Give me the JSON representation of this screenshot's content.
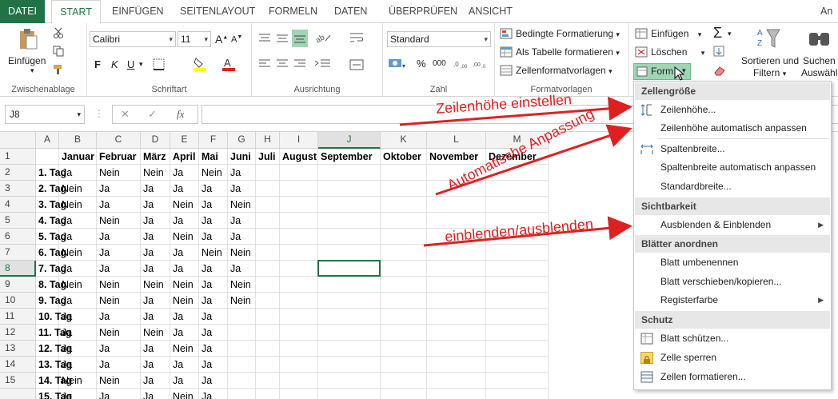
{
  "tabs": [
    "DATEI",
    "START",
    "EINFÜGEN",
    "SEITENLAYOUT",
    "FORMELN",
    "DATEN",
    "ÜBERPRÜFEN",
    "ANSICHT"
  ],
  "tabs_right": "An",
  "ribbon": {
    "clipboard": {
      "paste": "Einfügen",
      "label": "Zwischenablage"
    },
    "font": {
      "name": "Calibri",
      "size": "11",
      "label": "Schriftart",
      "bold": "F",
      "italic": "K",
      "underline": "U"
    },
    "alignment": {
      "label": "Ausrichtung"
    },
    "number": {
      "format": "Standard",
      "label": "Zahl",
      "percent": "%",
      "thousands": "000"
    },
    "styles": {
      "conditional": "Bedingte Formatierung",
      "table": "Als Tabelle formatieren",
      "cellstyles": "Zellenformatvorlagen",
      "label": "Formatvorlagen"
    },
    "cells": {
      "insert": "Einfügen",
      "delete": "Löschen",
      "format": "Form"
    },
    "editing": {
      "sort": "Sortieren und",
      "sort2": "Filtern",
      "find": "Suchen",
      "find2": "Auswähl"
    }
  },
  "formula_bar": {
    "namebox": "J8",
    "fx": "fx",
    "cancel": "✕",
    "confirm": "✓"
  },
  "columns": [
    "A",
    "B",
    "C",
    "D",
    "E",
    "F",
    "G",
    "H",
    "I",
    "J",
    "K",
    "L",
    "M"
  ],
  "rows": [
    [
      "",
      "Januar",
      "Februar",
      "März",
      "April",
      "Mai",
      "Juni",
      "Juli",
      "August",
      "September",
      "Oktober",
      "November",
      "Dezember"
    ],
    [
      "1. Tag",
      "Ja",
      "Nein",
      "Nein",
      "Ja",
      "Nein",
      "Ja"
    ],
    [
      "2. Tag",
      "Nein",
      "Ja",
      "Ja",
      "Ja",
      "Ja",
      "Ja"
    ],
    [
      "3. Tag",
      "Nein",
      "Ja",
      "Ja",
      "Nein",
      "Ja",
      "Nein"
    ],
    [
      "4. Tag",
      "Ja",
      "Nein",
      "Ja",
      "Ja",
      "Ja",
      "Ja"
    ],
    [
      "5. Tag",
      "Ja",
      "Ja",
      "Ja",
      "Nein",
      "Ja",
      "Ja"
    ],
    [
      "6. Tag",
      "Nein",
      "Ja",
      "Ja",
      "Ja",
      "Nein",
      "Nein"
    ],
    [
      "7. Tag",
      "Ja",
      "Ja",
      "Ja",
      "Ja",
      "Ja",
      "Ja"
    ],
    [
      "8. Tag",
      "Nein",
      "Nein",
      "Nein",
      "Nein",
      "Ja",
      "Nein"
    ],
    [
      "9. Tag",
      "Ja",
      "Nein",
      "Ja",
      "Nein",
      "Ja",
      "Nein"
    ],
    [
      "10. Tag",
      "Ja",
      "Ja",
      "Ja",
      "Ja",
      "Ja",
      ""
    ],
    [
      "11. Tag",
      "Ja",
      "Nein",
      "Nein",
      "Ja",
      "Ja",
      ""
    ],
    [
      "12. Tag",
      "Ja",
      "Ja",
      "Ja",
      "Nein",
      "Ja",
      ""
    ],
    [
      "13. Tag",
      "Ja",
      "Ja",
      "Ja",
      "Ja",
      "Ja",
      ""
    ],
    [
      "14. Tag",
      "Nein",
      "Nein",
      "Ja",
      "Ja",
      "Ja",
      ""
    ],
    [
      "15. Tag",
      "Ja",
      "Ja",
      "Ja",
      "Nein",
      "Ja",
      ""
    ]
  ],
  "row_numbers": [
    "1",
    "2",
    "3",
    "4",
    "5",
    "6",
    "7",
    "8",
    "9",
    "10",
    "11",
    "12",
    "13",
    "14",
    "15"
  ],
  "menu": {
    "h1": "Zellengröße",
    "i1": "Zeilenhöhe...",
    "i2": "Zeilenhöhe automatisch anpassen",
    "i3": "Spaltenbreite...",
    "i4": "Spaltenbreite automatisch anpassen",
    "i5": "Standardbreite...",
    "h2": "Sichtbarkeit",
    "i6": "Ausblenden & Einblenden",
    "h3": "Blätter anordnen",
    "i7": "Blatt umbenennen",
    "i8": "Blatt verschieben/kopieren...",
    "i9": "Registerfarbe",
    "h4": "Schutz",
    "i10": "Blatt schützen...",
    "i11": "Zelle sperren",
    "i12": "Zellen formatieren..."
  },
  "annotations": {
    "a1": "Zeilenhöhe einstellen",
    "a2": "Automatische Anpassung",
    "a3": "einblenden/ausblenden"
  },
  "colors": {
    "accent": "#217346",
    "annotation": "#e02020",
    "selected_button": "#9fd5b5"
  }
}
